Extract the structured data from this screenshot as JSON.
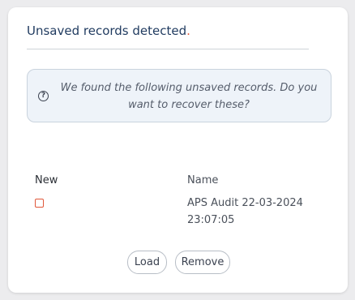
{
  "dialog": {
    "title": "Unsaved records detected",
    "title_accent": ".",
    "accent_color": "#e0573a",
    "title_color": "#1f3a5f",
    "info": {
      "icon": "question-circle-icon",
      "icon_glyph": "?",
      "message": "We found the following unsaved records. Do you want to recover these?"
    },
    "table": {
      "columns": [
        "New",
        "Name"
      ],
      "rows": [
        {
          "new_checked": false,
          "name": "APS Audit 22-03-2024 23:07:05"
        }
      ]
    },
    "buttons": {
      "load_label": "Load",
      "remove_label": "Remove"
    }
  }
}
